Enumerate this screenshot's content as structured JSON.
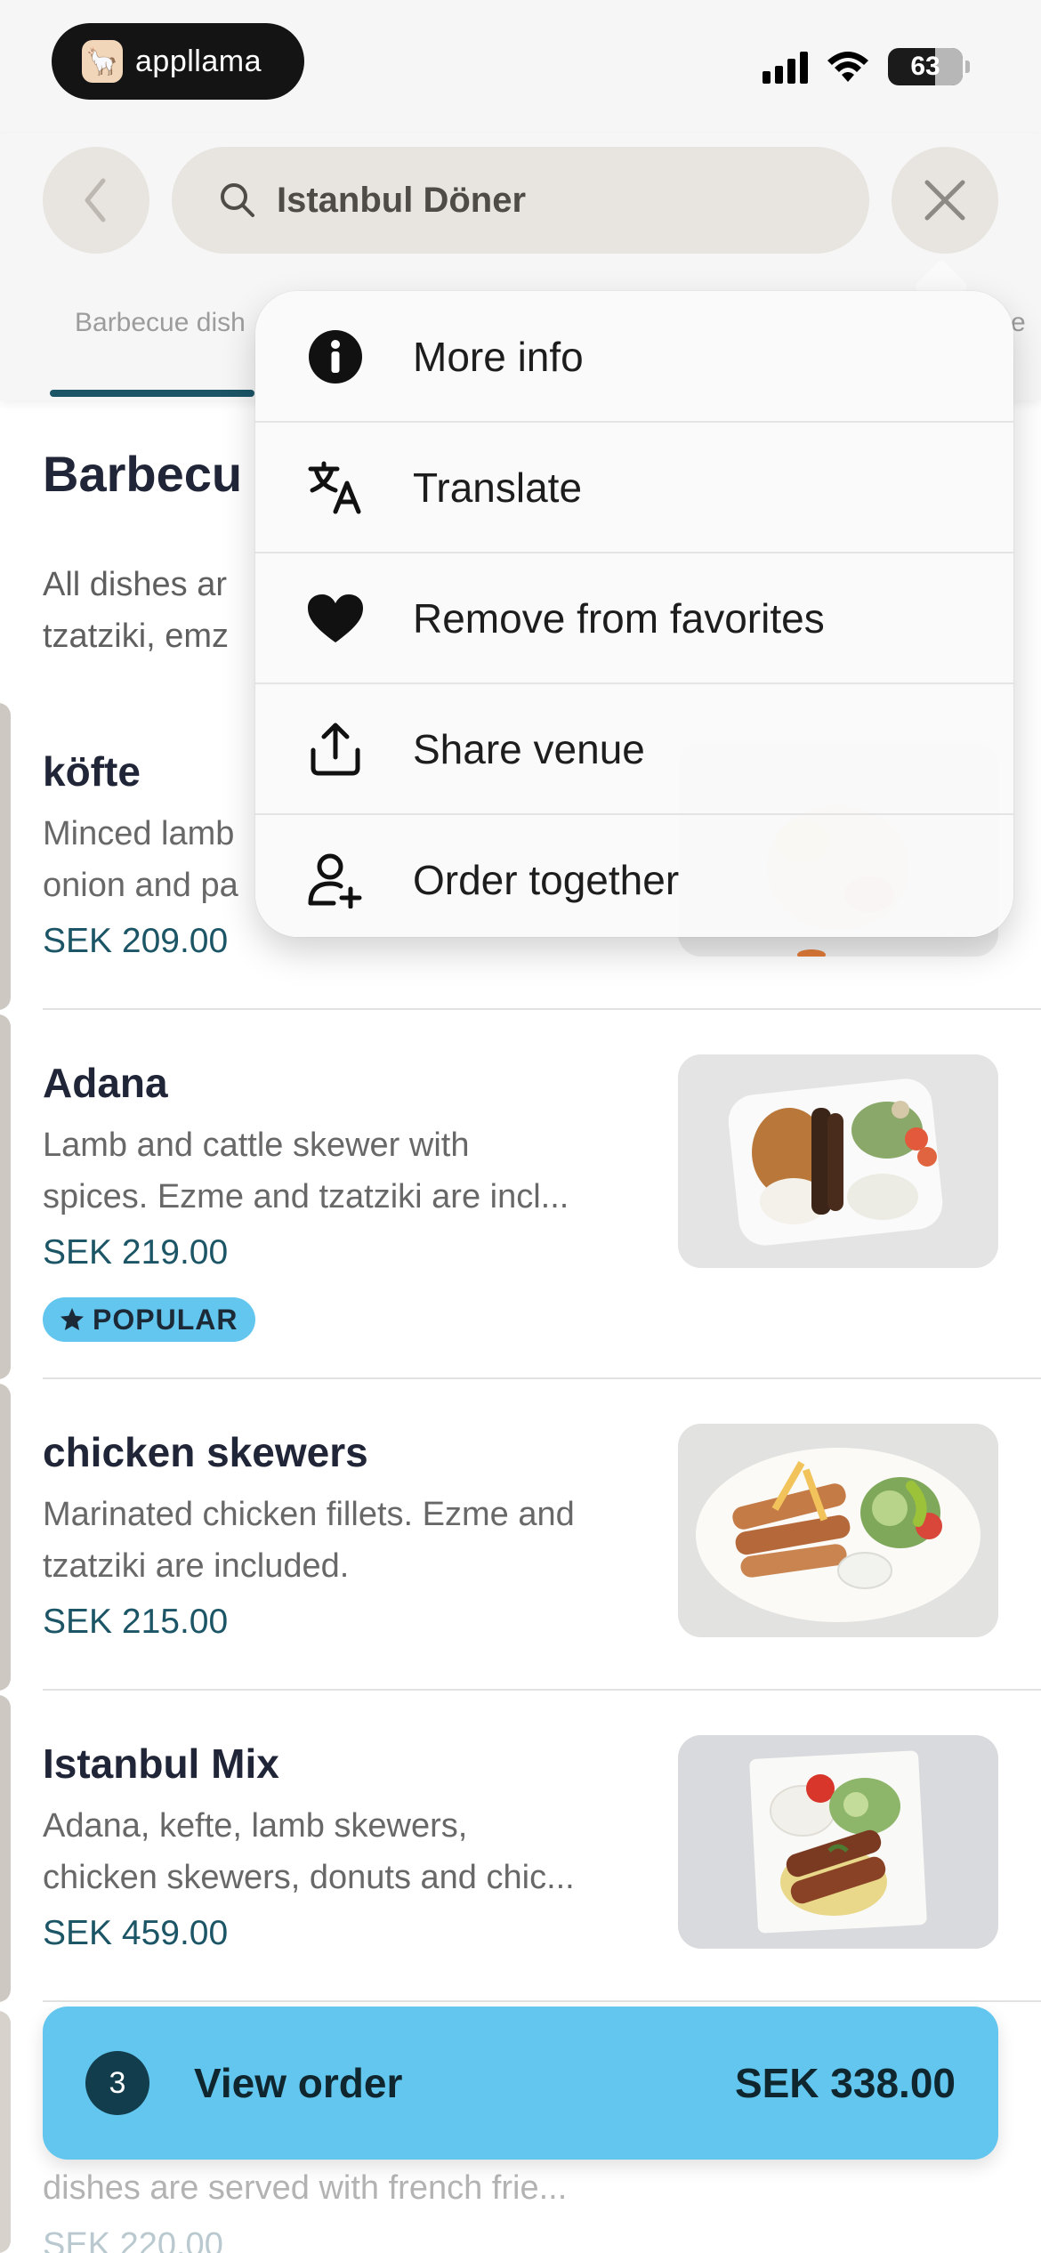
{
  "status_bar": {
    "app_name": "appllama",
    "battery": "63",
    "battery_level": 0.63
  },
  "header": {
    "search_text": "Istanbul Döner",
    "tabs": [
      "Barbecue dish",
      "e"
    ]
  },
  "section": {
    "title": "Barbecu",
    "description_lines": [
      "All dishes ar",
      "tzatziki, emz"
    ]
  },
  "menu": {
    "items": [
      {
        "label": "More info",
        "icon": "info-icon"
      },
      {
        "label": "Translate",
        "icon": "translate-icon"
      },
      {
        "label": "Remove from favorites",
        "icon": "heart-icon"
      },
      {
        "label": "Share venue",
        "icon": "share-icon"
      },
      {
        "label": "Order together",
        "icon": "add-person-icon"
      }
    ]
  },
  "items": [
    {
      "name": "köfte",
      "desc_lines": [
        "Minced lamb",
        "onion and pa"
      ],
      "price": "SEK 209.00"
    },
    {
      "name": "Adana",
      "desc_lines": [
        "Lamb and cattle skewer with",
        "spices. Ezme and tzatziki are incl..."
      ],
      "price": "SEK 219.00",
      "badge": "POPULAR"
    },
    {
      "name": "chicken skewers",
      "desc_lines": [
        "Marinated chicken fillets. Ezme and",
        "tzatziki are included."
      ],
      "price": "SEK 215.00"
    },
    {
      "name": "Istanbul Mix",
      "desc_lines": [
        "Adana, kefte, lamb skewers,",
        "chicken skewers, donuts and chic..."
      ],
      "price": "SEK 459.00"
    }
  ],
  "view_order": {
    "count": "3",
    "label": "View order",
    "total": "SEK 338.00"
  },
  "partial_item": {
    "desc_fragment": "dishes are served with french frie...",
    "price_fragment": "SEK 220.00"
  },
  "colors": {
    "accent": "#63c6ee",
    "price": "#1b5566",
    "dark_badge": "#123d4c"
  }
}
